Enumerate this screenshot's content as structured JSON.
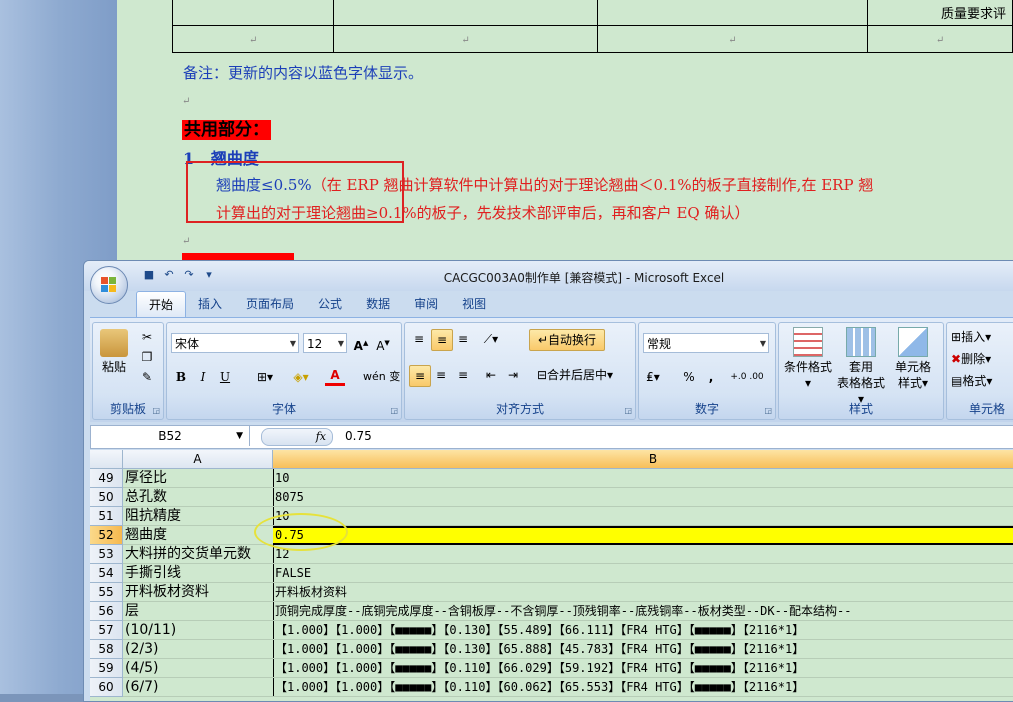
{
  "word": {
    "table_cell_text": "质量要求评",
    "return_mark": "↵",
    "note": "备注：更新的内容以蓝色字体显示。",
    "section_heading": "共用部分：",
    "item_number": "1",
    "item_title": "翘曲度",
    "warp_spec": "翘曲度≤0.5%",
    "warp_detail_line1": "（在 ERP 翘曲计算软件中计算出的对于理论翘曲＜0.1%的板子直接制作,在 ERP 翘",
    "warp_detail_line2": "计算出的对于理论翘曲≥0.1%的板子，先发技术部评审后，再和客户 EQ 确认）"
  },
  "excel": {
    "window_title": "CACGC003A0制作单 [兼容模式] - Microsoft Excel",
    "tabs": [
      {
        "label": "开始"
      },
      {
        "label": "插入"
      },
      {
        "label": "页面布局"
      },
      {
        "label": "公式"
      },
      {
        "label": "数据"
      },
      {
        "label": "审阅"
      },
      {
        "label": "视图"
      }
    ],
    "ribbon": {
      "clipboard": {
        "paste": "粘贴",
        "group": "剪贴板"
      },
      "font": {
        "name": "宋体",
        "size": "12",
        "group": "字体",
        "bold": "B",
        "italic": "I",
        "underline": "U",
        "font_color_glyph": "A",
        "phonetic": "wén 变"
      },
      "alignment": {
        "wrap_text": "自动换行",
        "merge_center": "合并后居中",
        "group": "对齐方式"
      },
      "number": {
        "format": "常规",
        "percent": "%",
        "comma": ",",
        "group": "数字",
        "inc_dec": "+.0 .00"
      },
      "styles": {
        "conditional": "条件格式",
        "table_format_1": "套用",
        "table_format_2": "表格格式",
        "cell_style_1": "单元格",
        "cell_style_2": "样式",
        "group": "样式"
      },
      "cells": {
        "insert": "插入",
        "delete": "删除",
        "format": "格式",
        "group": "单元格"
      }
    },
    "formula_bar": {
      "name_box": "B52",
      "fx": "fx",
      "value": "0.75"
    },
    "columns": [
      "A",
      "B"
    ],
    "rows": [
      {
        "num": "49",
        "a": "厚径比",
        "b": "10"
      },
      {
        "num": "50",
        "a": "总孔数",
        "b": "8075"
      },
      {
        "num": "51",
        "a": "阻抗精度",
        "b": "10"
      },
      {
        "num": "52",
        "a": "翘曲度",
        "b": "0.75",
        "selected": true
      },
      {
        "num": "53",
        "a": "大料拼的交货单元数",
        "b": "12"
      },
      {
        "num": "54",
        "a": "手撕引线",
        "b": "FALSE"
      },
      {
        "num": "55",
        "a": "开料板材资料",
        "b": "开料板材资料"
      },
      {
        "num": "56",
        "a": "层",
        "b": "顶铜完成厚度--底铜完成厚度--含铜板厚--不含铜厚--顶残铜率--底残铜率--板材类型--DK--配本结构--"
      },
      {
        "num": "57",
        "a": "(10/11)",
        "b": "【1.000】【1.000】【■■■■■】【0.130】【55.489】【66.111】【FR4 HTG】【■■■■■】【2116*1】"
      },
      {
        "num": "58",
        "a": "(2/3)",
        "b": "【1.000】【1.000】【■■■■■】【0.130】【65.888】【45.783】【FR4 HTG】【■■■■■】【2116*1】"
      },
      {
        "num": "59",
        "a": "(4/5)",
        "b": "【1.000】【1.000】【■■■■■】【0.110】【66.029】【59.192】【FR4 HTG】【■■■■■】【2116*1】"
      },
      {
        "num": "60",
        "a": "(6/7)",
        "b": "【1.000】【1.000】【■■■■■】【0.110】【60.062】【65.553】【FR4 HTG】【■■■■■】【2116*1】"
      }
    ]
  },
  "colors": {
    "highlight_red": "#ff0000",
    "blue_text": "#1c3fb8",
    "red_text": "#e02020",
    "selected_fill": "#ffff00"
  }
}
